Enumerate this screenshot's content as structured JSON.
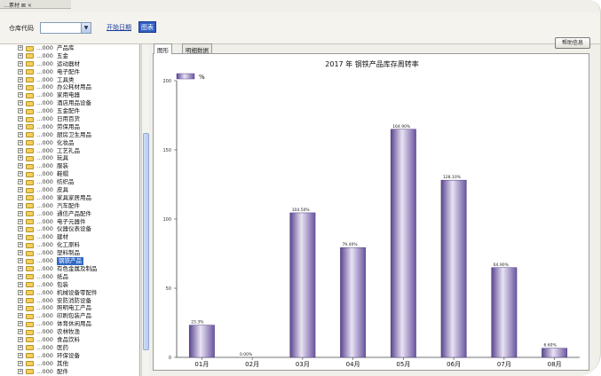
{
  "window": {
    "title": "…素材 ⊠ ×"
  },
  "toolbar": {
    "warehouse_label": "仓库代码",
    "warehouse_value": "",
    "query_link": "开始日期",
    "chart_button": "图表",
    "action_button": "帮助信息"
  },
  "tree": {
    "items": [
      {
        "code": "…000",
        "name": "产品库"
      },
      {
        "code": "…000",
        "name": "五金"
      },
      {
        "code": "…000",
        "name": "运动器材"
      },
      {
        "code": "…000",
        "name": "电子配件"
      },
      {
        "code": "…000",
        "name": "工具类"
      },
      {
        "code": "…000",
        "name": "办公耗材用品"
      },
      {
        "code": "…000",
        "name": "家用电器"
      },
      {
        "code": "…000",
        "name": "酒店用品设备"
      },
      {
        "code": "…000",
        "name": "五金配件"
      },
      {
        "code": "…000",
        "name": "日用百货"
      },
      {
        "code": "…000",
        "name": "劳保用品"
      },
      {
        "code": "…000",
        "name": "厨房卫生用品"
      },
      {
        "code": "…000",
        "name": "化妆品"
      },
      {
        "code": "…000",
        "name": "工艺礼品"
      },
      {
        "code": "…000",
        "name": "玩具"
      },
      {
        "code": "…000",
        "name": "服装"
      },
      {
        "code": "…000",
        "name": "鞋帽"
      },
      {
        "code": "…000",
        "name": "纺织品"
      },
      {
        "code": "…000",
        "name": "皮具"
      },
      {
        "code": "…000",
        "name": "家具家居用品"
      },
      {
        "code": "…000",
        "name": "汽车配件"
      },
      {
        "code": "…000",
        "name": "通信产品配件"
      },
      {
        "code": "…000",
        "name": "电子元器件"
      },
      {
        "code": "…000",
        "name": "仪器仪表设备"
      },
      {
        "code": "…000",
        "name": "建材"
      },
      {
        "code": "…000",
        "name": "化工原料"
      },
      {
        "code": "…000",
        "name": "塑料制品"
      },
      {
        "code": "…000",
        "name": "钢铁产品",
        "selected": true
      },
      {
        "code": "…000",
        "name": "有色金属及制品"
      },
      {
        "code": "…000",
        "name": "纸品"
      },
      {
        "code": "…000",
        "name": "包装"
      },
      {
        "code": "…000",
        "name": "机械设备零配件"
      },
      {
        "code": "…000",
        "name": "安防消防设备"
      },
      {
        "code": "…000",
        "name": "照明电工产品"
      },
      {
        "code": "…000",
        "name": "印刷包装产品"
      },
      {
        "code": "…000",
        "name": "体育休闲用品"
      },
      {
        "code": "…000",
        "name": "农林牧渔"
      },
      {
        "code": "…000",
        "name": "食品饮料"
      },
      {
        "code": "…000",
        "name": "医药"
      },
      {
        "code": "…000",
        "name": "环保设备"
      },
      {
        "code": "…000",
        "name": "其他"
      },
      {
        "code": "…000",
        "name": "配件"
      }
    ]
  },
  "tabs": [
    {
      "label": "图形"
    },
    {
      "label": "明细数据"
    }
  ],
  "chart_data": {
    "type": "bar",
    "title": "2017 年 钢铁产品库存周转率",
    "legend": [
      "%"
    ],
    "legend_position": "top-left",
    "categories": [
      "01月",
      "02月",
      "03月",
      "04月",
      "05月",
      "06月",
      "07月",
      "08月"
    ],
    "values": [
      23.3,
      0.0,
      104.5,
      79.4,
      164.9,
      128.1,
      64.9,
      6.6
    ],
    "value_labels": [
      "23.3%",
      "0.00%",
      "104.50%",
      "79.40%",
      "164.90%",
      "128.10%",
      "64.90%",
      "6.60%"
    ],
    "yticks": [
      0,
      50,
      100,
      150,
      200
    ],
    "ylim": [
      0,
      200
    ],
    "grid": false,
    "bar_color": "#7b64a8"
  }
}
